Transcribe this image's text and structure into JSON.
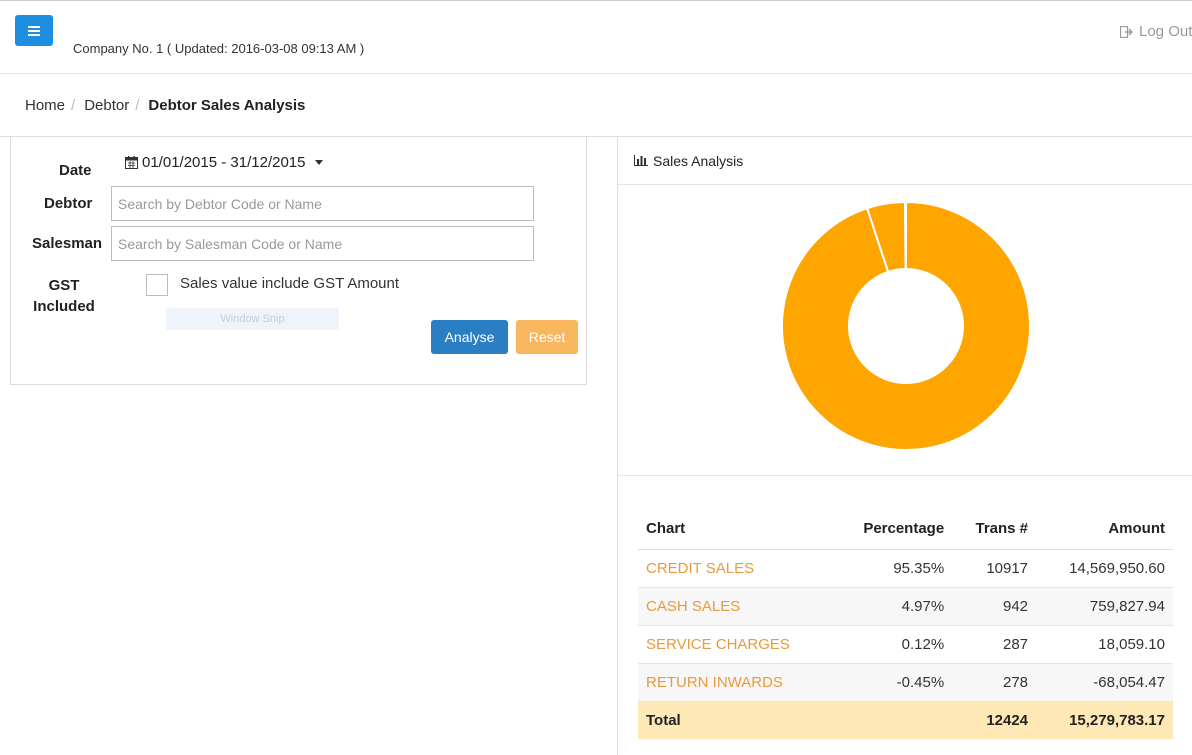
{
  "header": {
    "menu_icon": "hamburger-icon",
    "company_info": "Company No. 1 ( Updated: 2016-03-08 09:13 AM )",
    "logout_label": "Log Out",
    "logout_icon": "sign-out-icon"
  },
  "breadcrumb": {
    "home": "Home",
    "debtor": "Debtor",
    "current": "Debtor Sales Analysis"
  },
  "filters": {
    "date_label": "Date",
    "date_icon": "calendar-icon",
    "date_range": "01/01/2015 - 31/12/2015",
    "debtor_label": "Debtor",
    "debtor_placeholder": "Search by Debtor Code or Name",
    "salesman_label": "Salesman",
    "salesman_placeholder": "Search by Salesman Code or Name",
    "gst_label_line1": "GST",
    "gst_label_line2": "Included",
    "gst_checkbox_label": "Sales value include GST Amount",
    "gst_checked": false,
    "snip_overlay": "Window Snip",
    "analyse_label": "Analyse",
    "reset_label": "Reset"
  },
  "analysis": {
    "title": "Sales Analysis",
    "title_icon": "bar-chart-icon",
    "colors": {
      "orange": "#ffa500",
      "accent_text": "#e89a3c",
      "total_bg": "#fde8b6"
    },
    "chart_data": {
      "type": "pie",
      "title": "",
      "donut": true,
      "categories": [
        "CREDIT SALES",
        "CASH SALES",
        "SERVICE CHARGES",
        "RETURN INWARDS"
      ],
      "values": [
        95.35,
        4.97,
        0.12,
        -0.45
      ],
      "colors": [
        "#ffa500",
        "#ffa500",
        "#ffa500",
        "#ffa500"
      ]
    },
    "table": {
      "headers": {
        "chart": "Chart",
        "percentage": "Percentage",
        "trans": "Trans #",
        "amount": "Amount"
      },
      "rows": [
        {
          "chart": "CREDIT SALES",
          "percentage": "95.35%",
          "trans": "10917",
          "amount": "14,569,950.60"
        },
        {
          "chart": "CASH SALES",
          "percentage": "4.97%",
          "trans": "942",
          "amount": "759,827.94"
        },
        {
          "chart": "SERVICE CHARGES",
          "percentage": "0.12%",
          "trans": "287",
          "amount": "18,059.10"
        },
        {
          "chart": "RETURN INWARDS",
          "percentage": "-0.45%",
          "trans": "278",
          "amount": "-68,054.47"
        }
      ],
      "total": {
        "label": "Total",
        "percentage": "",
        "trans": "12424",
        "amount": "15,279,783.17"
      }
    }
  }
}
